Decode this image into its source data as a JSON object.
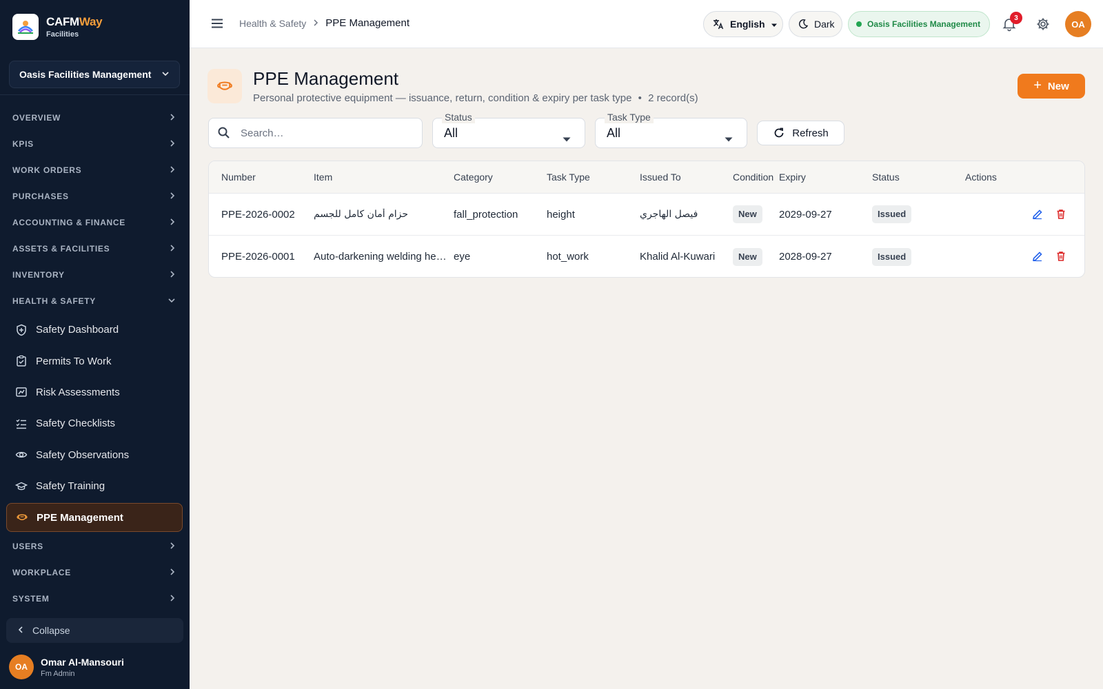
{
  "brand": {
    "name_main": "CAFM",
    "name_accent": "Way",
    "subtitle": "Facilities"
  },
  "sidebar": {
    "org_selector": "Oasis Facilities Management",
    "sections_top": [
      {
        "label": "OVERVIEW"
      },
      {
        "label": "KPIS"
      },
      {
        "label": "WORK ORDERS"
      },
      {
        "label": "PURCHASES"
      },
      {
        "label": "ACCOUNTING & FINANCE"
      },
      {
        "label": "ASSETS & FACILITIES"
      },
      {
        "label": "INVENTORY"
      }
    ],
    "expanded_section": "HEALTH & SAFETY",
    "items": [
      {
        "label": "Safety Dashboard",
        "icon": "shield-plus-icon"
      },
      {
        "label": "Permits To Work",
        "icon": "clipboard-check-icon"
      },
      {
        "label": "Risk Assessments",
        "icon": "chart-box-icon"
      },
      {
        "label": "Safety Checklists",
        "icon": "checklist-icon"
      },
      {
        "label": "Safety Observations",
        "icon": "eye-icon"
      },
      {
        "label": "Safety Training",
        "icon": "graduation-cap-icon"
      },
      {
        "label": "PPE Management",
        "icon": "mask-icon",
        "active": true
      }
    ],
    "sections_bottom": [
      {
        "label": "USERS"
      },
      {
        "label": "WORKPLACE"
      },
      {
        "label": "SYSTEM"
      }
    ],
    "collapse_label": "Collapse",
    "user": {
      "initials": "OA",
      "name": "Omar Al-Mansouri",
      "role": "Fm Admin"
    }
  },
  "topbar": {
    "breadcrumb_parent": "Health & Safety",
    "breadcrumb_current": "PPE Management",
    "language": "English",
    "theme": "Dark",
    "org_badge": "Oasis Facilities Management",
    "notification_count": "3",
    "avatar_initials": "OA"
  },
  "page": {
    "title": "PPE Management",
    "subtitle": "Personal protective equipment — issuance, return, condition & expiry per task type",
    "record_count": "2 record(s)",
    "new_button": "New"
  },
  "filters": {
    "search_placeholder": "Search…",
    "status_label": "Status",
    "status_value": "All",
    "task_type_label": "Task Type",
    "task_type_value": "All",
    "refresh_label": "Refresh"
  },
  "table": {
    "columns": [
      "Number",
      "Item",
      "Category",
      "Task Type",
      "Issued To",
      "Condition",
      "Expiry",
      "Status",
      "Actions"
    ],
    "rows": [
      {
        "number": "PPE-2026-0002",
        "item": "حزام أمان كامل للجسم",
        "category": "fall_protection",
        "task_type": "height",
        "issued_to": "فيصل الهاجري",
        "condition": "New",
        "expiry": "2029-09-27",
        "status": "Issued"
      },
      {
        "number": "PPE-2026-0001",
        "item": "Auto-darkening welding hel…",
        "category": "eye",
        "task_type": "hot_work",
        "issued_to": "Khalid Al-Kuwari",
        "condition": "New",
        "expiry": "2028-09-27",
        "status": "Issued"
      }
    ]
  },
  "colors": {
    "accent": "#f07a1d",
    "sidebar_bg": "#0f1b2e",
    "edit_icon": "#2563eb",
    "delete_icon": "#dc2626",
    "org_badge": "#1f8a47"
  }
}
